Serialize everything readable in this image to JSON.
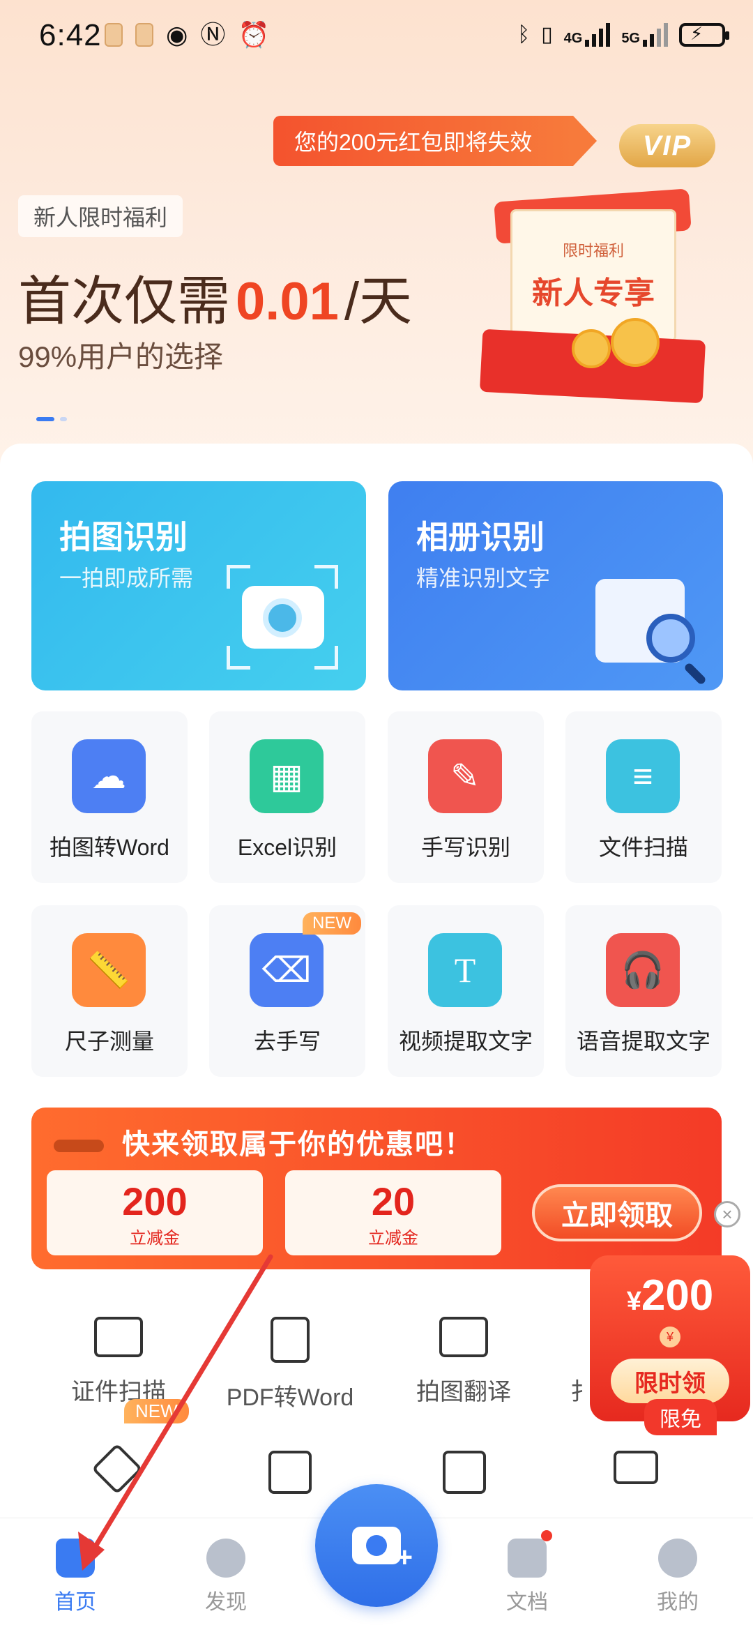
{
  "status_bar": {
    "time": "6:42",
    "network_1": "4G",
    "network_2": "5G"
  },
  "banner": {
    "promo_text": "您的200元红包即将失效",
    "vip_label": "VIP",
    "newbie_tag": "新人限时福利",
    "headline_prefix": "首次仅需",
    "headline_price": "0.01",
    "headline_suffix": "/天",
    "subline": "99%用户的选择",
    "gift_small": "限时福利",
    "gift_big": "新人专享"
  },
  "feature_cards": [
    {
      "title": "拍图识别",
      "subtitle": "一拍即成所需"
    },
    {
      "title": "相册识别",
      "subtitle": "精准识别文字"
    }
  ],
  "tools": [
    {
      "label": "拍图转Word",
      "icon": "cloud-image-icon",
      "color": "#4d7ff3"
    },
    {
      "label": "Excel识别",
      "icon": "table-icon",
      "color": "#2ec99a"
    },
    {
      "label": "手写识别",
      "icon": "brush-icon",
      "color": "#f0554f"
    },
    {
      "label": "文件扫描",
      "icon": "document-scan-icon",
      "color": "#3cc2e0"
    },
    {
      "label": "尺子测量",
      "icon": "ruler-icon",
      "color": "#ff8a3d"
    },
    {
      "label": "去手写",
      "icon": "eraser-icon",
      "color": "#4d7ff3",
      "badge": "NEW"
    },
    {
      "label": "视频提取文字",
      "icon": "video-text-icon",
      "color": "#3cc2e0"
    },
    {
      "label": "语音提取文字",
      "icon": "headphones-icon",
      "color": "#f0554f"
    }
  ],
  "coupon": {
    "title": "快来领取属于你的优惠吧！",
    "tickets": [
      {
        "amount": "200",
        "caption": "立减金"
      },
      {
        "amount": "20",
        "caption": "立减金"
      }
    ],
    "claim_label": "立即领取",
    "close_glyph": "×"
  },
  "red_packet": {
    "currency": "¥",
    "amount": "200",
    "coin": "¥",
    "button": "限时领"
  },
  "small_tools": [
    {
      "label": "证件扫描",
      "icon": "id-card-icon"
    },
    {
      "label": "PDF转Word",
      "icon": "pdf-word-icon"
    },
    {
      "label": "拍图翻译",
      "icon": "camera-translate-icon"
    },
    {
      "label": "扌",
      "icon": "partial-tool-icon"
    }
  ],
  "row2_badges": {
    "new": "NEW",
    "free": "限免"
  },
  "bottom_nav": [
    {
      "label": "首页",
      "active": true
    },
    {
      "label": "发现",
      "active": false
    },
    {
      "label": "文档",
      "active": false
    },
    {
      "label": "我的",
      "active": false
    }
  ],
  "colors": {
    "accent": "#3a7bf2",
    "promo": "#f4532e",
    "annotation_arrow": "#e53935"
  }
}
